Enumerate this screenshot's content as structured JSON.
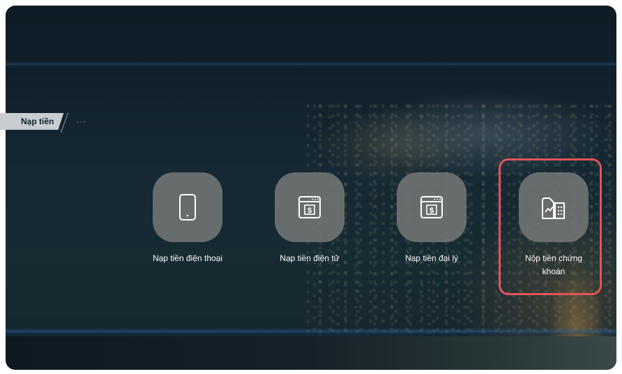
{
  "breadcrumb": {
    "current": "Nạp tiền",
    "more": "···"
  },
  "tiles": [
    {
      "label": "Nạp tiền điện thoại",
      "icon": "phone-icon"
    },
    {
      "label": "Nạp tiền điện tử",
      "icon": "dollar-window-icon"
    },
    {
      "label": "Nạp tiền đại lý",
      "icon": "dollar-window-icon"
    },
    {
      "label": "Nộp tiền chứng khoán",
      "icon": "stock-building-icon"
    }
  ],
  "colors": {
    "highlight": "#e2555a",
    "tile_bg": "#737674",
    "background": "#152833"
  }
}
